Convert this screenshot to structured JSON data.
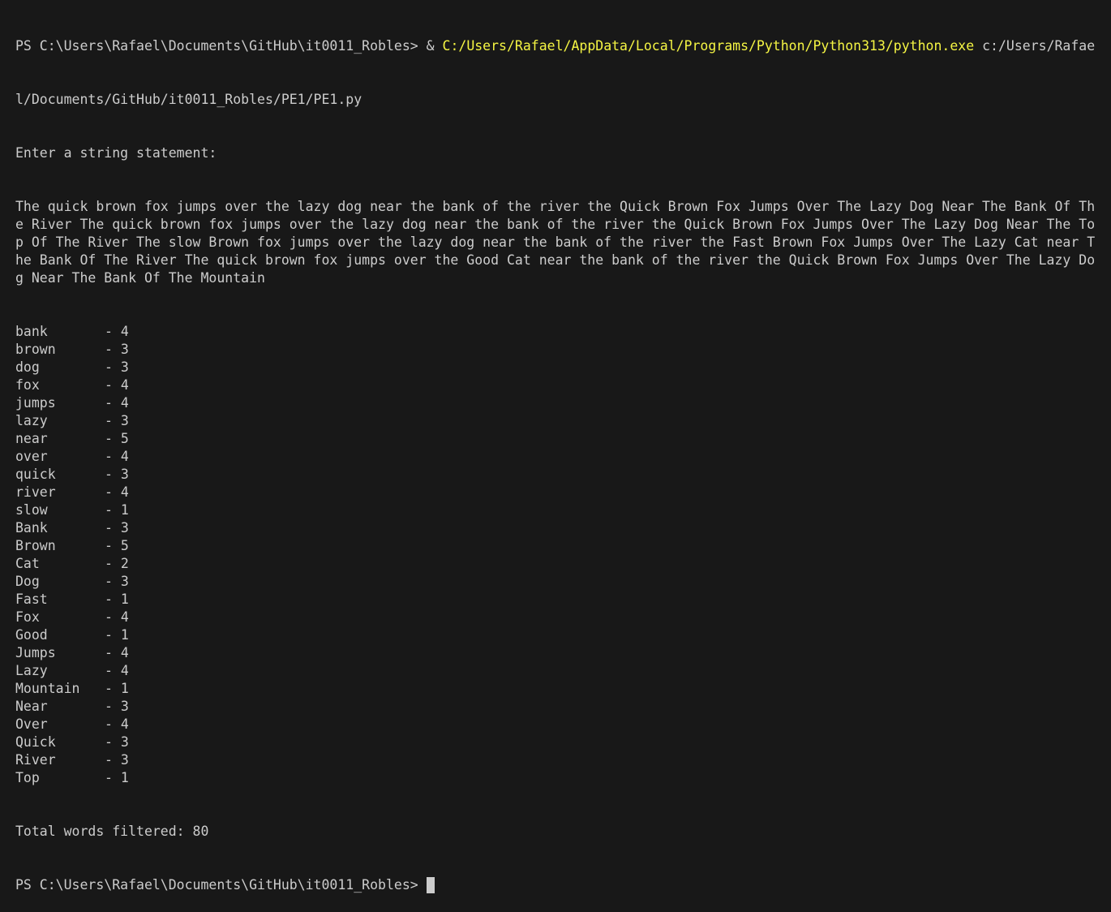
{
  "prompt": "PS C:\\Users\\Rafael\\Documents\\GitHub\\it0011_Robles>",
  "command": {
    "op": "&",
    "exe": "C:/Users/Rafael/AppData/Local/Programs/Python/Python313/python.exe",
    "arg_line1": "c:/Users/Rafae",
    "arg_line2": "l/Documents/GitHub/it0011_Robles/PE1/PE1.py"
  },
  "input_prompt": "Enter a string statement:",
  "input_lines": [
    "The quick brown fox jumps over the lazy dog near the bank of the river the Quick Brown Fox Jumps Over The Lazy Dog Near The Bank Of Th",
    "e River The quick brown fox jumps over the lazy dog near the bank of the river the Quick Brown Fox Jumps Over The Lazy Dog Near The To",
    "p Of The River The slow Brown fox jumps over the lazy dog near the bank of the river the Fast Brown Fox Jumps Over The Lazy Cat near T",
    "he Bank Of The River The quick brown fox jumps over the Good Cat near the bank of the river the Quick Brown Fox Jumps Over The Lazy Do",
    "g Near The Bank Of The Mountain"
  ],
  "counts": [
    {
      "word": "bank",
      "count": "4"
    },
    {
      "word": "brown",
      "count": "3"
    },
    {
      "word": "dog",
      "count": "3"
    },
    {
      "word": "fox",
      "count": "4"
    },
    {
      "word": "jumps",
      "count": "4"
    },
    {
      "word": "lazy",
      "count": "3"
    },
    {
      "word": "near",
      "count": "5"
    },
    {
      "word": "over",
      "count": "4"
    },
    {
      "word": "quick",
      "count": "3"
    },
    {
      "word": "river",
      "count": "4"
    },
    {
      "word": "slow",
      "count": "1"
    },
    {
      "word": "Bank",
      "count": "3"
    },
    {
      "word": "Brown",
      "count": "5"
    },
    {
      "word": "Cat",
      "count": "2"
    },
    {
      "word": "Dog",
      "count": "3"
    },
    {
      "word": "Fast",
      "count": "1"
    },
    {
      "word": "Fox",
      "count": "4"
    },
    {
      "word": "Good",
      "count": "1"
    },
    {
      "word": "Jumps",
      "count": "4"
    },
    {
      "word": "Lazy",
      "count": "4"
    },
    {
      "word": "Mountain",
      "count": "1"
    },
    {
      "word": "Near",
      "count": "3"
    },
    {
      "word": "Over",
      "count": "4"
    },
    {
      "word": "Quick",
      "count": "3"
    },
    {
      "word": "River",
      "count": "3"
    },
    {
      "word": "Top",
      "count": "1"
    }
  ],
  "separator": "- ",
  "total_line": "Total words filtered: 80",
  "colors": {
    "background": "#181818",
    "text": "#cccccc",
    "path_highlight": "#f5f543"
  }
}
